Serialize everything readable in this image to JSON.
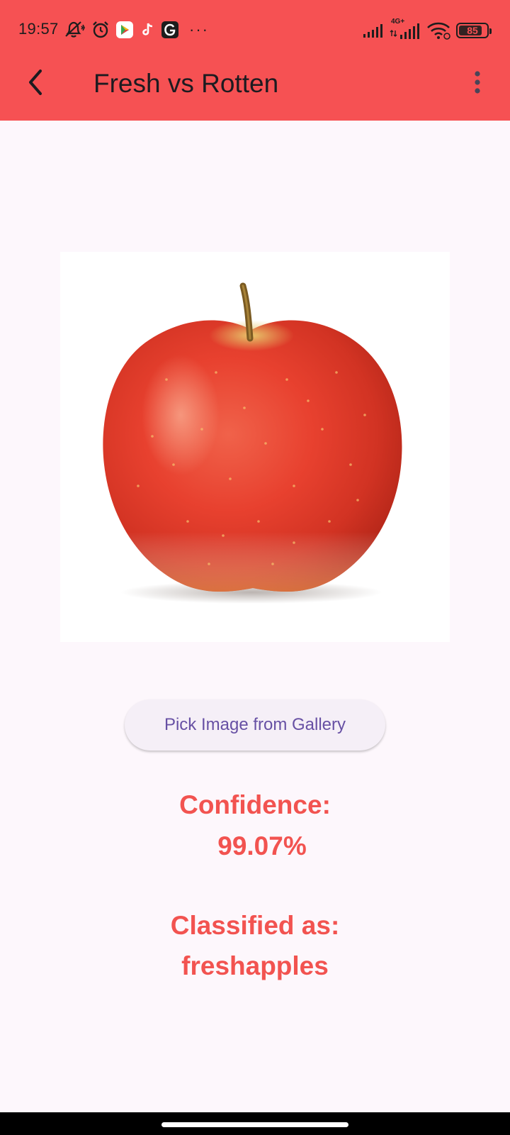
{
  "status_bar": {
    "time": "19:57",
    "overflow": "···",
    "network_label": "4G+",
    "battery": 85,
    "left_icons": [
      "notifications-muted-icon",
      "alarm-icon",
      "play-store-icon",
      "tiktok-icon",
      "g-app-icon"
    ],
    "right_icons": [
      "signal-icon",
      "signal-4g-icon",
      "wifi-icon",
      "battery-icon"
    ]
  },
  "app_bar": {
    "title": "Fresh vs Rotten",
    "back_icon": "back-arrow-icon",
    "menu_icon": "more-vert-icon",
    "background_color": "#f65153"
  },
  "preview": {
    "subject": "apple-photo"
  },
  "actions": {
    "pick_image_label": "Pick Image from Gallery"
  },
  "result": {
    "confidence_label": "Confidence:",
    "confidence_value": "99.07%",
    "classified_label": "Classified as:",
    "classified_value": "freshapples",
    "text_color": "#f25350"
  }
}
